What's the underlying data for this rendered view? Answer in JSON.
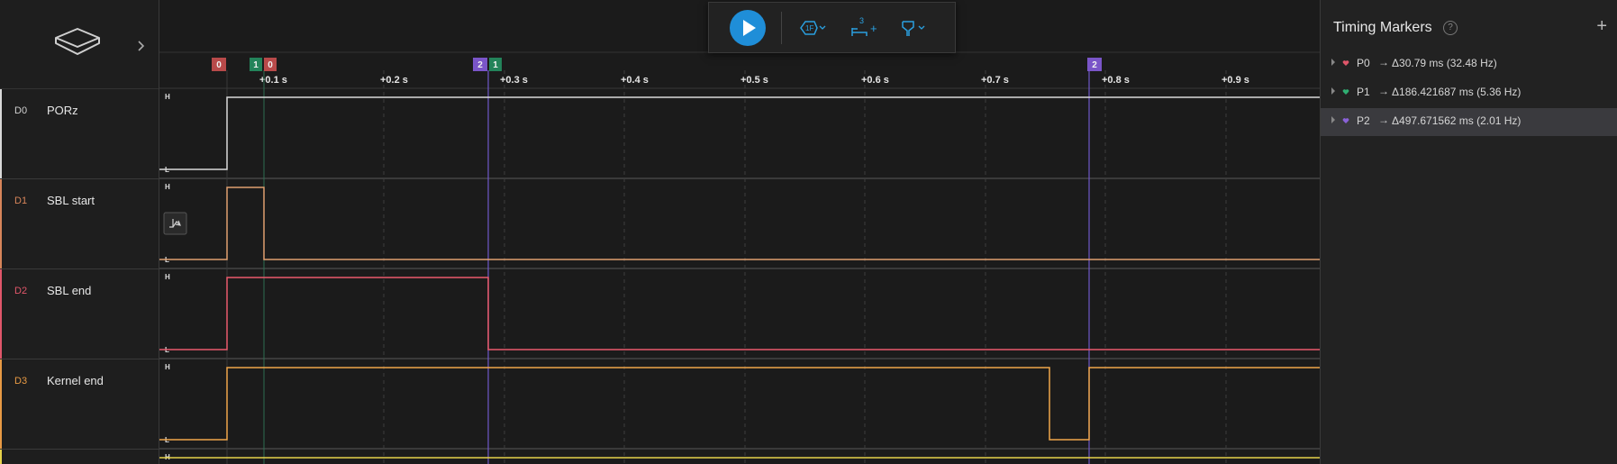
{
  "toolbar": {
    "play_icon": "play-icon",
    "trigger_icon": "trigger-icon",
    "measure_icon": "measure-icon",
    "measure_badge": "3",
    "measure_plus": "+",
    "filter_icon": "filter-icon"
  },
  "channels": [
    {
      "id": "D0",
      "name": "PORz",
      "color": "#d9d9d9",
      "id_color": "#cfcfcf"
    },
    {
      "id": "D1",
      "name": "SBL start",
      "color": "#e0a070",
      "id_color": "#d7855a"
    },
    {
      "id": "D2",
      "name": "SBL end",
      "color": "#ea5a6c",
      "id_color": "#e0566a"
    },
    {
      "id": "D3",
      "name": "Kernel end",
      "color": "#f0a64a",
      "id_color": "#e89a44"
    }
  ],
  "level_labels": {
    "high": "H",
    "low": "L"
  },
  "time_ticks": [
    "+0.1 s",
    "+0.2 s",
    "+0.3 s",
    "+0.4 s",
    "+0.5 s",
    "+0.6 s",
    "+0.7 s",
    "+0.8 s",
    "+0.9 s"
  ],
  "marker_flags": [
    {
      "label": "0",
      "color": "#b84a4a"
    },
    {
      "label": "1",
      "color": "#23835a"
    },
    {
      "label": "0",
      "color": "#b84a4a"
    },
    {
      "label": "2",
      "color": "#7a55c8"
    },
    {
      "label": "1",
      "color": "#23835a"
    },
    {
      "label": "2",
      "color": "#7a55c8"
    }
  ],
  "timing_panel": {
    "title": "Timing Markers",
    "help": "?",
    "add": "+",
    "markers": [
      {
        "name": "P0",
        "arrow": "→",
        "value": "Δ30.79 ms (32.48 Hz)",
        "color": "#e0566a"
      },
      {
        "name": "P1",
        "arrow": "→",
        "value": "Δ186.421687 ms (5.36 Hz)",
        "color": "#2fae72"
      },
      {
        "name": "P2",
        "arrow": "→",
        "value": "Δ497.671562 ms (2.01 Hz)",
        "color": "#8a62d8"
      }
    ]
  }
}
